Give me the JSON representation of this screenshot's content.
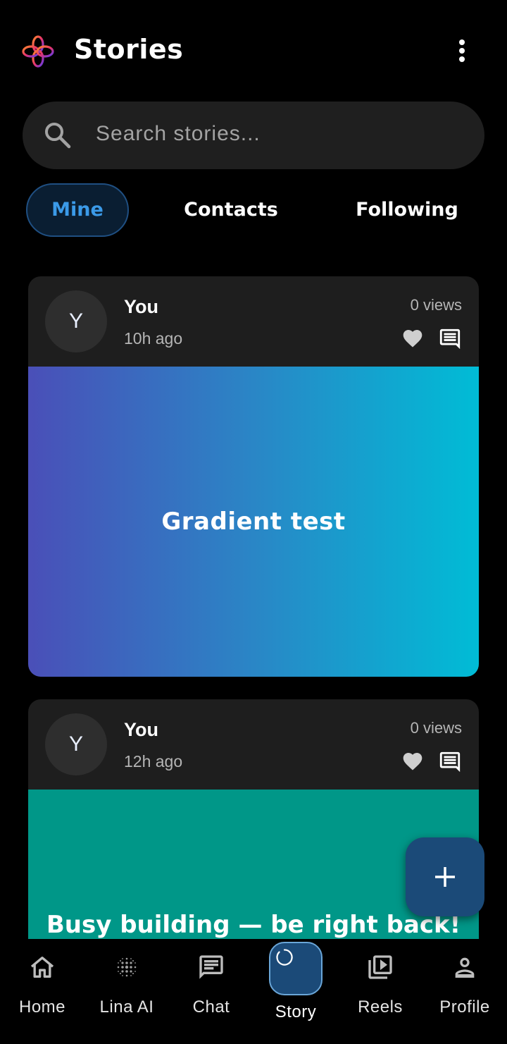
{
  "header": {
    "title": "Stories",
    "logo_icon": "flower-logo-icon",
    "menu_icon": "more-vertical-icon"
  },
  "search": {
    "placeholder": "Search stories...",
    "icon": "search-icon"
  },
  "tabs": [
    {
      "label": "Mine",
      "active": true
    },
    {
      "label": "Contacts",
      "active": false
    },
    {
      "label": "Following",
      "active": false
    }
  ],
  "stories": [
    {
      "avatar_letter": "Y",
      "author": "You",
      "time": "10h ago",
      "views": "0 views",
      "text": "Gradient test",
      "background": "linear-gradient(90deg, #4a4fb8 0%, #2a86c6 50%, #00bcd6 100%)"
    },
    {
      "avatar_letter": "Y",
      "author": "You",
      "time": "12h ago",
      "views": "0 views",
      "text": "Busy building — be right back!",
      "background": "#009788"
    }
  ],
  "fab": {
    "icon": "plus-icon"
  },
  "bottom_nav": [
    {
      "label": "Home",
      "icon": "home-icon"
    },
    {
      "label": "Lina AI",
      "icon": "dots-grid-icon"
    },
    {
      "label": "Chat",
      "icon": "chat-icon"
    },
    {
      "label": "Story",
      "icon": "story-ring-icon",
      "active": true
    },
    {
      "label": "Reels",
      "icon": "reels-icon"
    },
    {
      "label": "Profile",
      "icon": "profile-icon"
    }
  ],
  "colors": {
    "accent": "#3b9ae8",
    "surface": "#1e1e1e",
    "fab": "#1b4a78"
  }
}
